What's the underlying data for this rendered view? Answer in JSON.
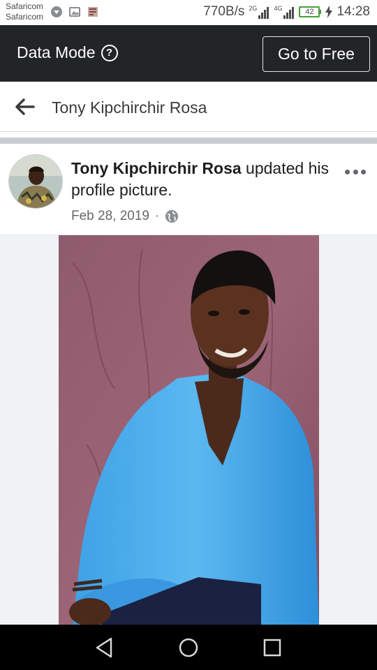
{
  "status_bar": {
    "carrier_1": "Safaricom",
    "carrier_2": "Safaricom",
    "speed": "770B/s",
    "net_1": "2G",
    "net_2": "4G",
    "battery": "42",
    "time": "14:28",
    "battery_color": "#4a9b3c"
  },
  "data_bar": {
    "label": "Data Mode",
    "help_glyph": "?",
    "button_label": "Go to Free",
    "background": "#232428"
  },
  "header": {
    "title": "Tony Kipchirchir Rosa"
  },
  "post": {
    "author": "Tony Kipchirchir Rosa",
    "action": " updated his profile picture.",
    "date": "Feb 28, 2019",
    "separator": "·",
    "audience_icon": "globe-icon",
    "more_icon": "more-options-icon"
  },
  "nav": {
    "icons": [
      "back-triangle-icon",
      "home-circle-icon",
      "recents-square-icon"
    ]
  }
}
